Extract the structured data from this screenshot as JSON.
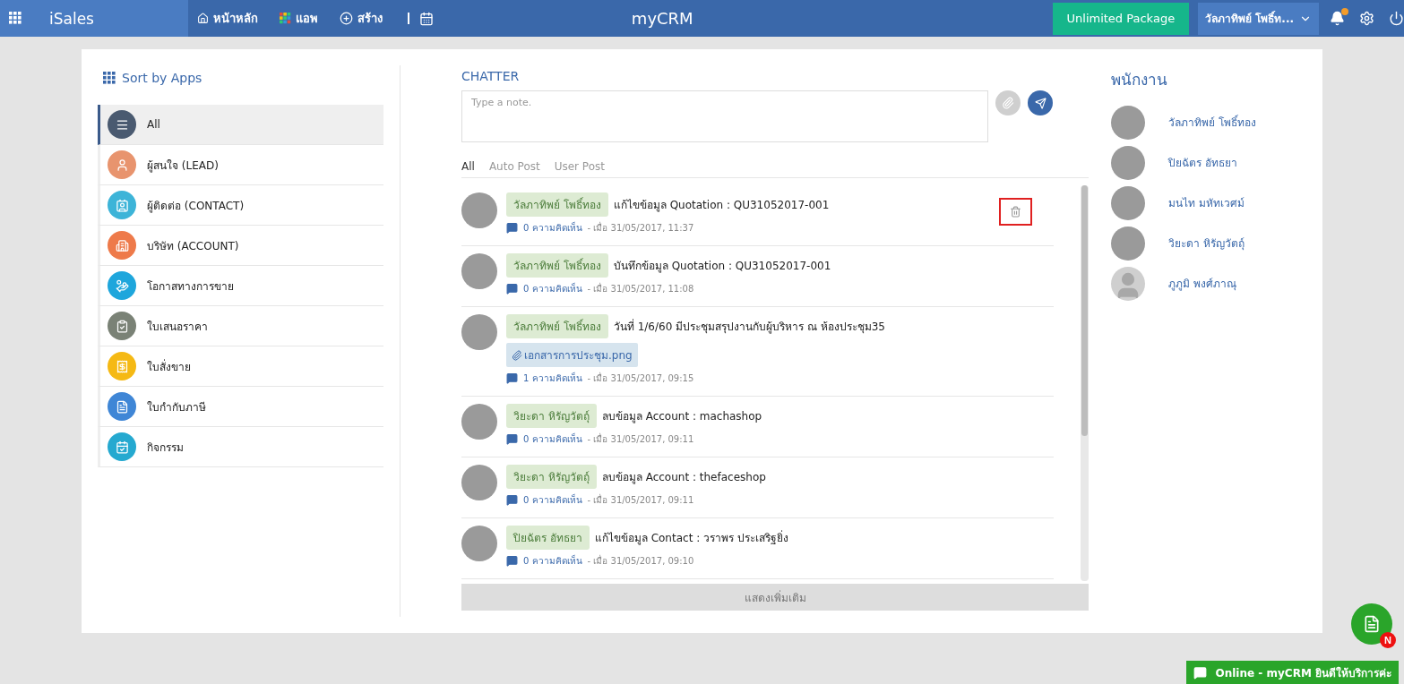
{
  "topbar": {
    "app_name": "iSales",
    "nav": [
      {
        "kind": "home",
        "label": "หน้าหลัก"
      },
      {
        "kind": "apps",
        "label": "แอพ"
      },
      {
        "kind": "create",
        "label": "สร้าง"
      },
      {
        "kind": "calendar"
      }
    ],
    "logo": "myCRM",
    "package_button": "Unlimited Package",
    "user_menu": "วัลภาทิพย์ โพธิ์ท...",
    "notification_dot": true
  },
  "sidebar": {
    "title": "Sort by Apps",
    "items": [
      {
        "label": "All",
        "color": "#4a5a70",
        "selected": true
      },
      {
        "label": "ผู้สนใจ (LEAD)",
        "color": "#e8946e",
        "selected": false
      },
      {
        "label": "ผู้ติดต่อ (CONTACT)",
        "color": "#3db4d8",
        "selected": false
      },
      {
        "label": "บริษัท (ACCOUNT)",
        "color": "#ee7a4a",
        "selected": false
      },
      {
        "label": "โอกาสทางการขาย",
        "color": "#1ea6dc",
        "selected": false
      },
      {
        "label": "ใบเสนอราคา",
        "color": "#7a8276",
        "selected": false
      },
      {
        "label": "ใบสั่งขาย",
        "color": "#f5b914",
        "selected": false
      },
      {
        "label": "ใบกำกับภาษี",
        "color": "#3f86d6",
        "selected": false
      },
      {
        "label": "กิจกรรม",
        "color": "#25a9d0",
        "selected": false
      }
    ]
  },
  "chatter": {
    "title": "CHATTER",
    "note": {
      "placeholder": "Type a note."
    },
    "tabs": [
      {
        "label": "All",
        "selected": true
      },
      {
        "label": "Auto Post",
        "selected": false
      },
      {
        "label": "User Post",
        "selected": false
      }
    ],
    "posts": [
      {
        "author": "วัลภาทิพย์ โพธิ์ทอง",
        "text": "แก้ไขข้อมูล Quotation : QU31052017-001",
        "comments": "0 ความคิดเห็น",
        "time": "- เมื่อ 31/05/2017, 11:37",
        "trash_highlighted": true
      },
      {
        "author": "วัลภาทิพย์ โพธิ์ทอง",
        "text": "บันทึกข้อมูล Quotation : QU31052017-001",
        "comments": "0 ความคิดเห็น",
        "time": "- เมื่อ 31/05/2017, 11:08",
        "trash_highlighted": false
      },
      {
        "author": "วัลภาทิพย์ โพธิ์ทอง",
        "text": "วันที่ 1/6/60 มีประชุมสรุปงานกับผู้บริหาร ณ ห้องประชุม35",
        "attachment": "เอกสารการประชุม.png",
        "comments": "1 ความคิดเห็น",
        "time": "- เมื่อ 31/05/2017, 09:15",
        "trash_highlighted": false
      },
      {
        "author": "วิยะดา หิรัญวัตถุ์",
        "text": "ลบข้อมูล Account : machashop",
        "comments": "0 ความคิดเห็น",
        "time": "- เมื่อ 31/05/2017, 09:11",
        "trash_highlighted": false
      },
      {
        "author": "วิยะดา หิรัญวัตถุ์",
        "text": "ลบข้อมูล Account : thefaceshop",
        "comments": "0 ความคิดเห็น",
        "time": "- เมื่อ 31/05/2017, 09:11",
        "trash_highlighted": false
      },
      {
        "author": "ปิยฉัตร อัทธยา",
        "text": "แก้ไขข้อมูล Contact : วราพร ประเสริฐยิ่ง",
        "comments": "0 ความคิดเห็น",
        "time": "- เมื่อ 31/05/2017, 09:10",
        "trash_highlighted": false
      }
    ],
    "more_button": "แสดงเพิ่มเติม"
  },
  "staff": {
    "title": "พนักงาน",
    "people": [
      {
        "name": "วัลภาทิพย์ โพธิ์ทอง",
        "kind": "photo"
      },
      {
        "name": "ปิยฉัตร อัทธยา",
        "kind": "photo"
      },
      {
        "name": "มนไท มหัทเวศม์",
        "kind": "photo"
      },
      {
        "name": "วิยะดา หิรัญวัตถุ์",
        "kind": "photo"
      },
      {
        "name": "ภูภูมิ พงศ์ภาณุ",
        "kind": "silhouette"
      }
    ]
  },
  "floating": {
    "badge": "N"
  },
  "chat_bar": {
    "label": "Online - myCRM ยินดีให้บริการค่ะ"
  }
}
